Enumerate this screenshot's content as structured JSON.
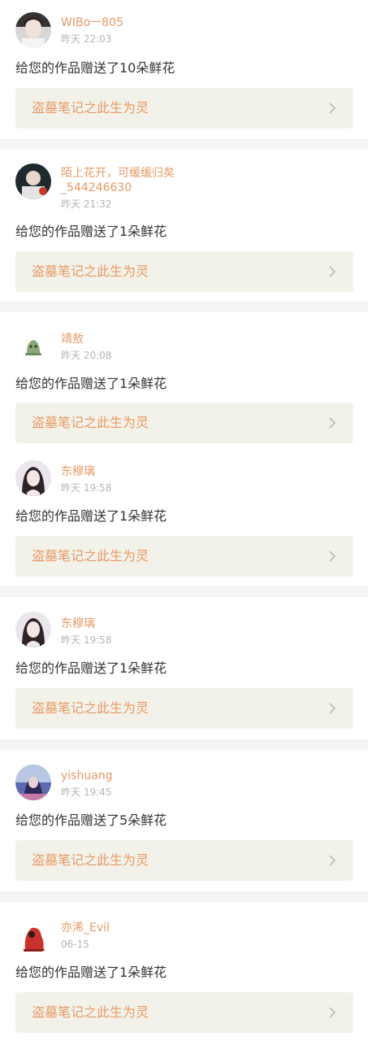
{
  "accent_color": "#e79a64",
  "notifications": [
    {
      "username": "WIBo一805",
      "time": "昨天 22:03",
      "message": "给您的作品赠送了10朵鲜花",
      "work_title": "盗墓笔记之此生为灵",
      "avatar_icon": "boy-photo-avatar"
    },
    {
      "username": "陌上花开，可缓缓归矣_544246630",
      "time": "昨天 21:32",
      "message": "给您的作品赠送了1朵鲜花",
      "work_title": "盗墓笔记之此生为灵",
      "avatar_icon": "character-art-avatar"
    },
    {
      "username": "靖敖",
      "time": "昨天 20:08",
      "message": "给您的作品赠送了1朵鲜花",
      "work_title": "盗墓笔记之此生为灵",
      "avatar_icon": "green-creature-avatar"
    },
    {
      "username": "东穆璃",
      "time": "昨天 19:58",
      "message": "给您的作品赠送了1朵鲜花",
      "work_title": "盗墓笔记之此生为灵",
      "avatar_icon": "girl-portrait-avatar"
    },
    {
      "username": "东穆璃",
      "time": "昨天 19:58",
      "message": "给您的作品赠送了1朵鲜花",
      "work_title": "盗墓笔记之此生为灵",
      "avatar_icon": "girl-portrait-avatar"
    },
    {
      "username": "yishuang",
      "time": "昨天 19:45",
      "message": "给您的作品赠送了5朵鲜花",
      "work_title": "盗墓笔记之此生为灵",
      "avatar_icon": "seaside-girl-avatar"
    },
    {
      "username": "亦浠_Evil",
      "time": "06-15",
      "message": "给您的作品赠送了1朵鲜花",
      "work_title": "盗墓笔记之此生为灵",
      "avatar_icon": "red-hoodie-avatar"
    }
  ]
}
